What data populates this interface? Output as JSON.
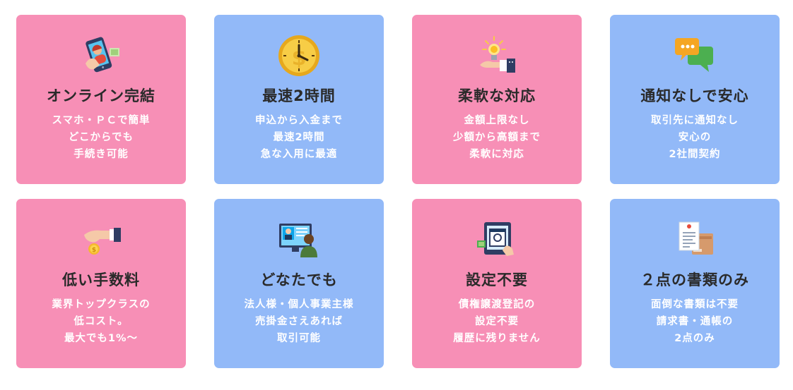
{
  "colors": {
    "pink": "#f78fb6",
    "blue": "#92b9f8",
    "title": "#2a2a2a",
    "text": "#ffffff"
  },
  "cards": [
    {
      "icon": "smartphone-operator-icon",
      "color": "pink",
      "title": "オンライン完結",
      "lines": [
        "スマホ・ＰＣで簡単",
        "どこからでも",
        "手続き可能"
      ]
    },
    {
      "icon": "clock-icon",
      "color": "blue",
      "title": "最速2時間",
      "lines": [
        "申込から入金まで",
        "最速2時間",
        "急な入用に最適"
      ]
    },
    {
      "icon": "lightbulb-hand-icon",
      "color": "pink",
      "title": "柔軟な対応",
      "lines": [
        "金額上限なし",
        "少額から高額まで",
        "柔軟に対応"
      ]
    },
    {
      "icon": "chat-bubbles-icon",
      "color": "blue",
      "title": "通知なしで安心",
      "lines": [
        "取引先に通知なし",
        "安心の",
        "2社間契約"
      ]
    },
    {
      "icon": "hand-coin-icon",
      "color": "pink",
      "title": "低い手数料",
      "lines": [
        "業界トップクラスの",
        "低コスト。",
        "最大でも1%〜"
      ]
    },
    {
      "icon": "video-call-icon",
      "color": "blue",
      "title": "どなたでも",
      "lines": [
        "法人様・個人事業主様",
        "売掛金さえあれば",
        "取引可能"
      ]
    },
    {
      "icon": "tablet-hand-icon",
      "color": "pink",
      "title": "設定不要",
      "lines": [
        "債権譲渡登記の",
        "設定不要",
        "履歴に残りません"
      ]
    },
    {
      "icon": "documents-icon",
      "color": "blue",
      "title": "２点の書類のみ",
      "lines": [
        "面倒な書類は不要",
        "請求書・通帳の",
        "2点のみ"
      ]
    }
  ]
}
